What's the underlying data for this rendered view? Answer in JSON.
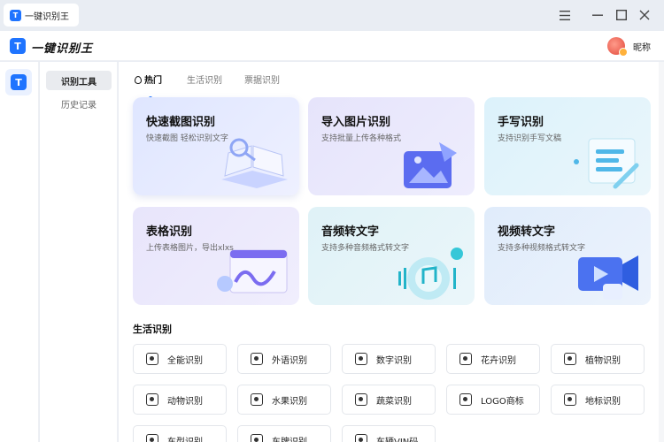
{
  "window": {
    "tab_title": "一键识别王",
    "logo_letter": "T",
    "controls": [
      "menu-icon",
      "minimize-icon",
      "maximize-icon",
      "close-icon"
    ]
  },
  "header": {
    "app_name": "一键识别王",
    "nickname": "昵称"
  },
  "subsidebar": {
    "items": [
      {
        "label": "识别工具",
        "active": true
      },
      {
        "label": "历史记录",
        "active": false
      }
    ]
  },
  "category_tabs": [
    {
      "label": "热门",
      "active": true
    },
    {
      "label": "生活识别",
      "active": false
    },
    {
      "label": "票据识别",
      "active": false
    }
  ],
  "cards": [
    {
      "title": "快速截图识别",
      "subtitle": "快速截图 轻松识别文字",
      "icon": "book-magnifier-icon"
    },
    {
      "title": "导入图片识别",
      "subtitle": "支持批量上传各种格式",
      "icon": "image-import-icon"
    },
    {
      "title": "手写识别",
      "subtitle": "支持识别手写文稿",
      "icon": "handwriting-document-icon"
    },
    {
      "title": "表格识别",
      "subtitle": "上传表格图片，导出xlxs",
      "icon": "table-chart-icon"
    },
    {
      "title": "音频转文字",
      "subtitle": "支持多种音频格式转文字",
      "icon": "audio-disc-icon"
    },
    {
      "title": "视频转文字",
      "subtitle": "支持多种视频格式转文字",
      "icon": "video-play-icon"
    }
  ],
  "life_section": {
    "title": "生活识别",
    "chips": [
      {
        "label": "全能识别",
        "icon": "eye-scan-icon"
      },
      {
        "label": "外语识别",
        "icon": "abc-scan-icon"
      },
      {
        "label": "数字识别",
        "icon": "number-scan-icon"
      },
      {
        "label": "花卉识别",
        "icon": "flower-icon"
      },
      {
        "label": "植物识别",
        "icon": "plant-icon"
      },
      {
        "label": "动物识别",
        "icon": "animal-icon"
      },
      {
        "label": "水果识别",
        "icon": "fruit-icon"
      },
      {
        "label": "蔬菜识别",
        "icon": "vegetable-icon"
      },
      {
        "label": "LOGO商标",
        "icon": "logo-trademark-icon"
      },
      {
        "label": "地标识别",
        "icon": "landmark-icon"
      },
      {
        "label": "车型识别",
        "icon": "car-icon"
      },
      {
        "label": "车牌识别",
        "icon": "license-plate-icon"
      },
      {
        "label": "车辆VIN码",
        "icon": "vin-icon"
      }
    ]
  },
  "colors": {
    "accent": "#1f74ff",
    "card_bg": [
      "#e3e9ff",
      "#e9e7fb",
      "#e2f4fb",
      "#ebe7fb",
      "#e2f3f8",
      "#e3eefc"
    ]
  }
}
